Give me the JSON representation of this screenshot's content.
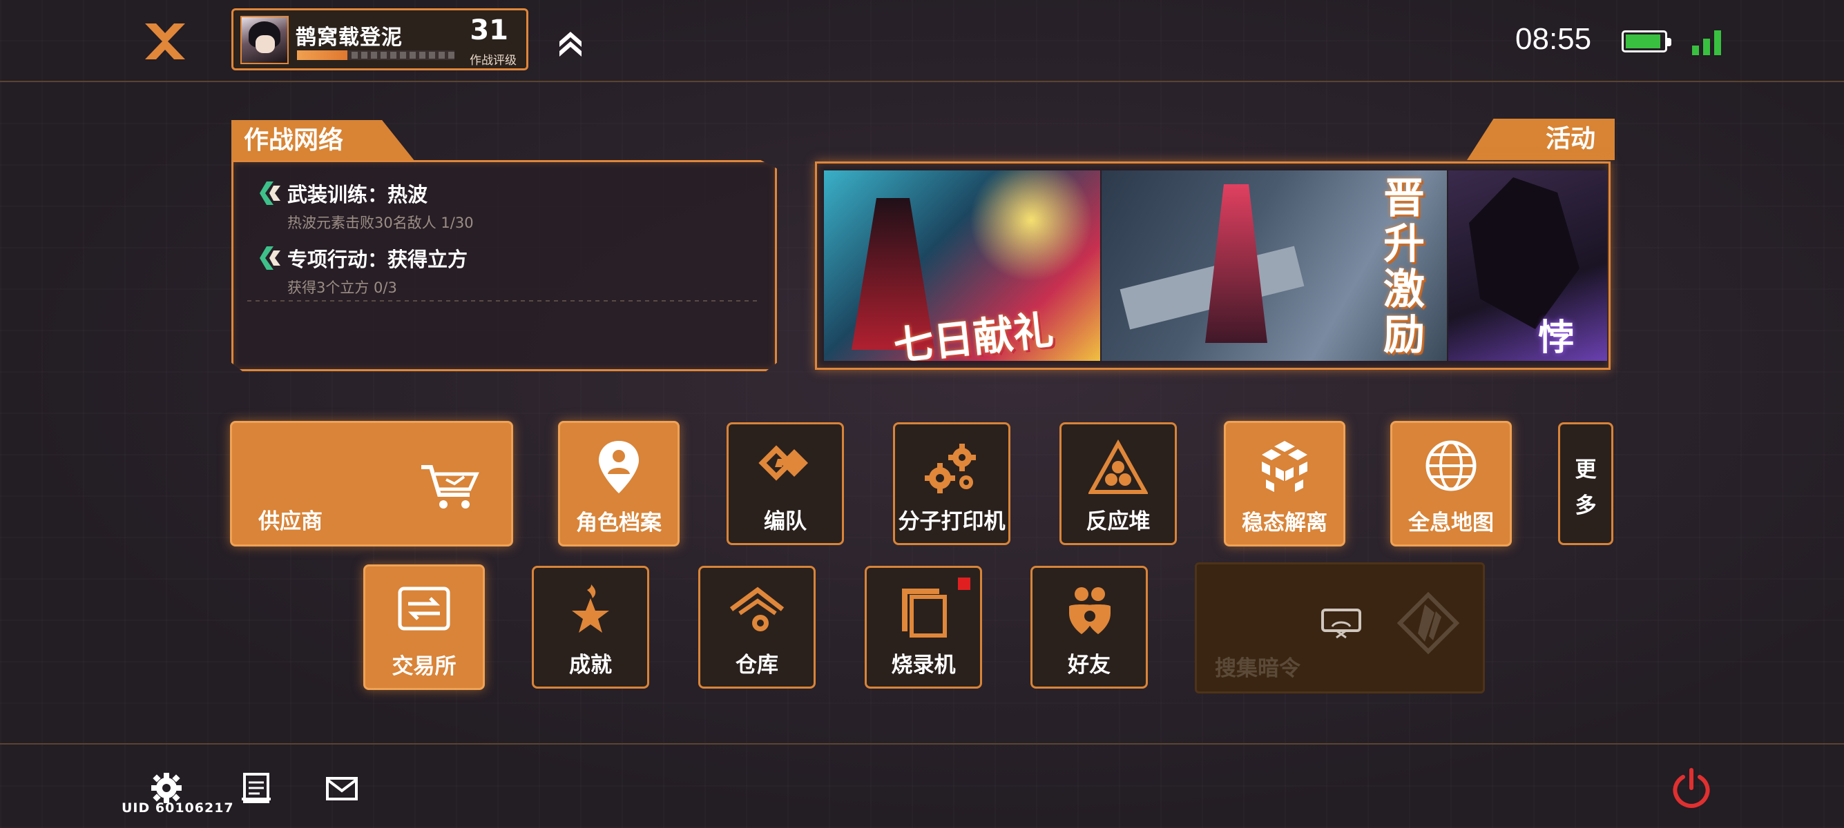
{
  "topbar": {
    "close_icon": "close-x-icon",
    "profile": {
      "name": "鹊窝载登泥",
      "level": "31",
      "rank_label": "作战评级",
      "exp_progress": 0.32
    },
    "rank_up_icon": "double-chevron-up-icon",
    "clock": "08:55",
    "battery_level": 0.92,
    "signal": "signal-bars-icon"
  },
  "combat_network": {
    "title": "作战网络",
    "quests": [
      {
        "title": "武装训练：热波",
        "progress": "热波元素击败30名敌人 1/30"
      },
      {
        "title": "专项行动：获得立方",
        "progress": "获得3个立方 0/3"
      }
    ]
  },
  "events": {
    "title": "活动",
    "banners": [
      {
        "text": "七日献礼"
      },
      {
        "text": "晋升激励"
      },
      {
        "text": "悖论"
      }
    ]
  },
  "menu": {
    "row1": [
      {
        "label": "供应商",
        "icon": "shopping-cart-icon"
      },
      {
        "label": "角色档案",
        "icon": "map-pin-person-icon"
      },
      {
        "label": "编队",
        "icon": "diamond-link-icon"
      },
      {
        "label": "分子打印机",
        "icon": "gears-icon"
      },
      {
        "label": "反应堆",
        "icon": "reactor-triangle-icon"
      },
      {
        "label": "稳态解离",
        "icon": "cube-grid-icon"
      },
      {
        "label": "全息地图",
        "icon": "globe-icon"
      }
    ],
    "more_label": "更多",
    "row2": [
      {
        "label": "交易所",
        "icon": "exchange-arrows-icon"
      },
      {
        "label": "成就",
        "icon": "star-flame-icon"
      },
      {
        "label": "仓库",
        "icon": "warehouse-icon"
      },
      {
        "label": "烧录机",
        "icon": "burner-frame-icon"
      },
      {
        "label": "好友",
        "icon": "friends-icon"
      }
    ],
    "locked": {
      "label": "搜集暗令",
      "icon": "wifi-x-icon"
    }
  },
  "bottombar": {
    "uid": "UID 60106217",
    "settings_icon": "gear-icon",
    "notice_icon": "notice-board-icon",
    "mail_icon": "mail-icon",
    "power_icon": "power-icon"
  },
  "colors": {
    "accent": "#d98438",
    "background": "#231d24",
    "power": "#e03030",
    "status_green": "#39c040",
    "notify_dot": "#e02020"
  }
}
